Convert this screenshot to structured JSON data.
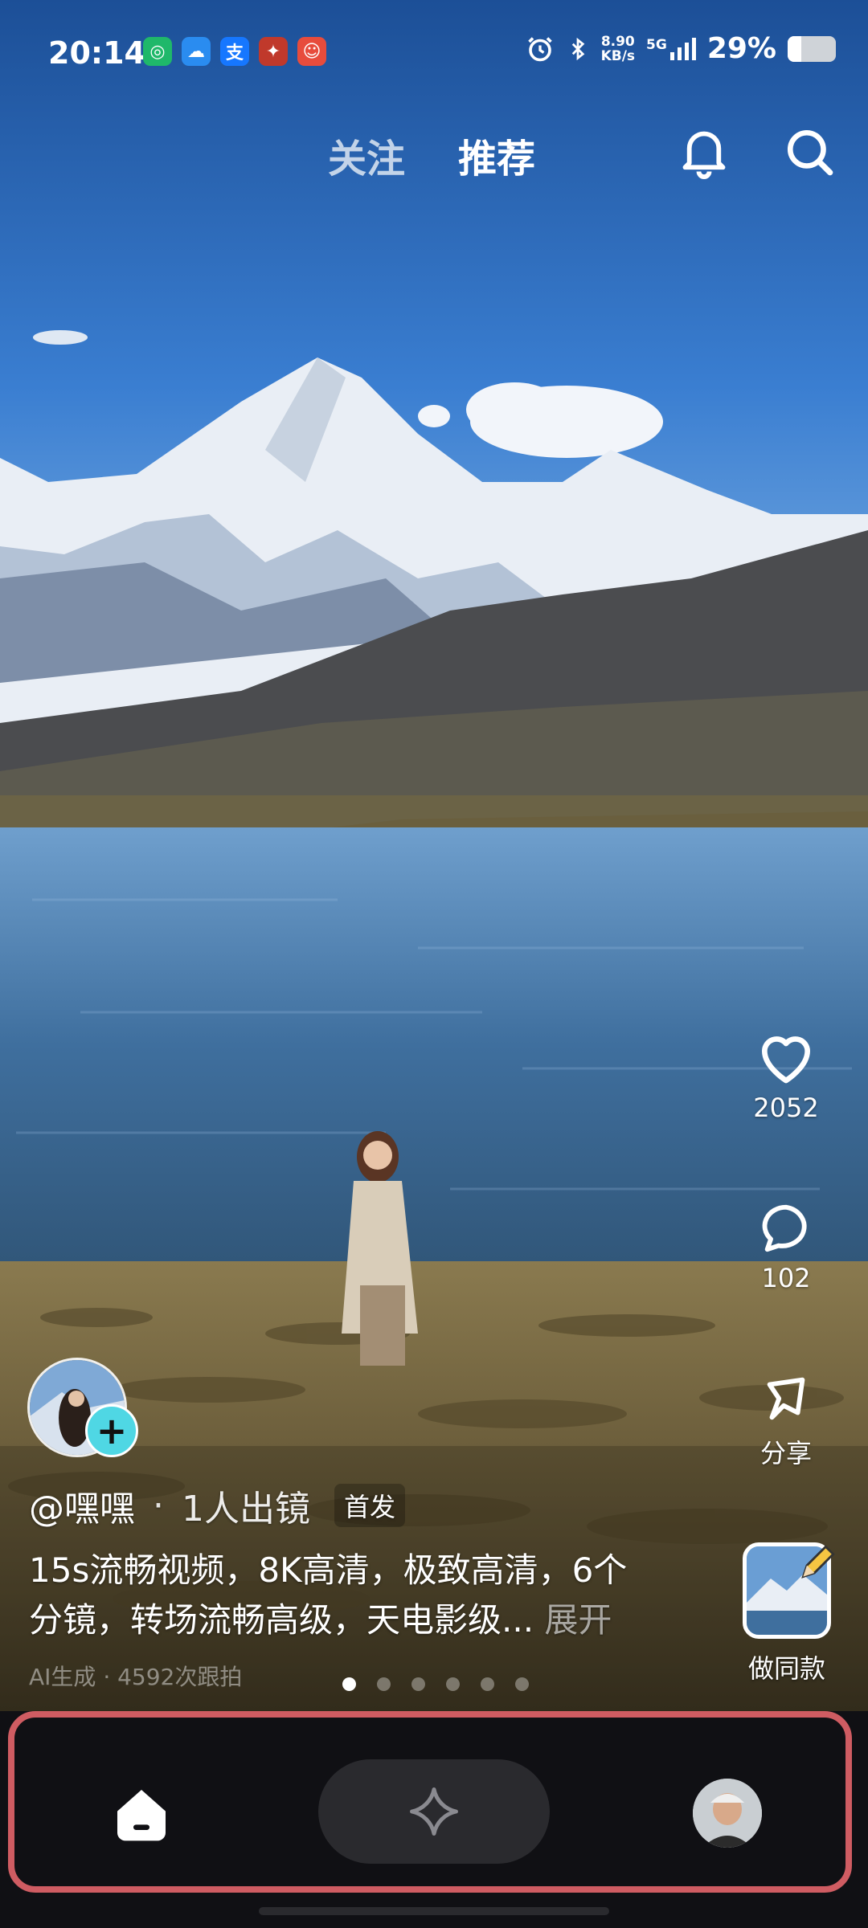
{
  "status_bar": {
    "time": "20:14",
    "app_icons": [
      {
        "name": "app-green-icon",
        "glyph": "◎",
        "color": "#1fb86a"
      },
      {
        "name": "app-cloud-icon",
        "glyph": "☁",
        "color": "#2a8cf0"
      },
      {
        "name": "alipay-icon",
        "glyph": "支",
        "color": "#1677ff"
      },
      {
        "name": "game-app-icon",
        "glyph": "✦",
        "color": "#c0392b"
      },
      {
        "name": "app-red-icon",
        "glyph": "☺",
        "color": "#e74c3c"
      }
    ],
    "net_speed_value": "8.90",
    "net_speed_unit": "KB/s",
    "network_type": "5G",
    "battery_percent_text": "29%",
    "battery_level": 0.29
  },
  "top_tabs": {
    "follow_label": "关注",
    "recommend_label": "推荐"
  },
  "actions": {
    "like_count": "2052",
    "comment_count": "102",
    "share_label": "分享",
    "make_same_label": "做同款"
  },
  "post": {
    "author": "@嘿嘿",
    "separator": "·",
    "meta": "1人出镜",
    "badge": "首发",
    "caption_line1": "15s流畅视频，8K高清，极致高清，6个",
    "caption_line2": "分镜，转场流畅高级，天电影级...",
    "expand_label": "展开",
    "ai_info": "AI生成 · 4592次跟拍",
    "follow_symbol": "+"
  },
  "pager": {
    "count": 6,
    "active_index": 0
  },
  "colors": {
    "accent_follow": "#4fd7e4",
    "nav_highlight_border": "#cf5c62",
    "nav_bg": "#101014"
  }
}
